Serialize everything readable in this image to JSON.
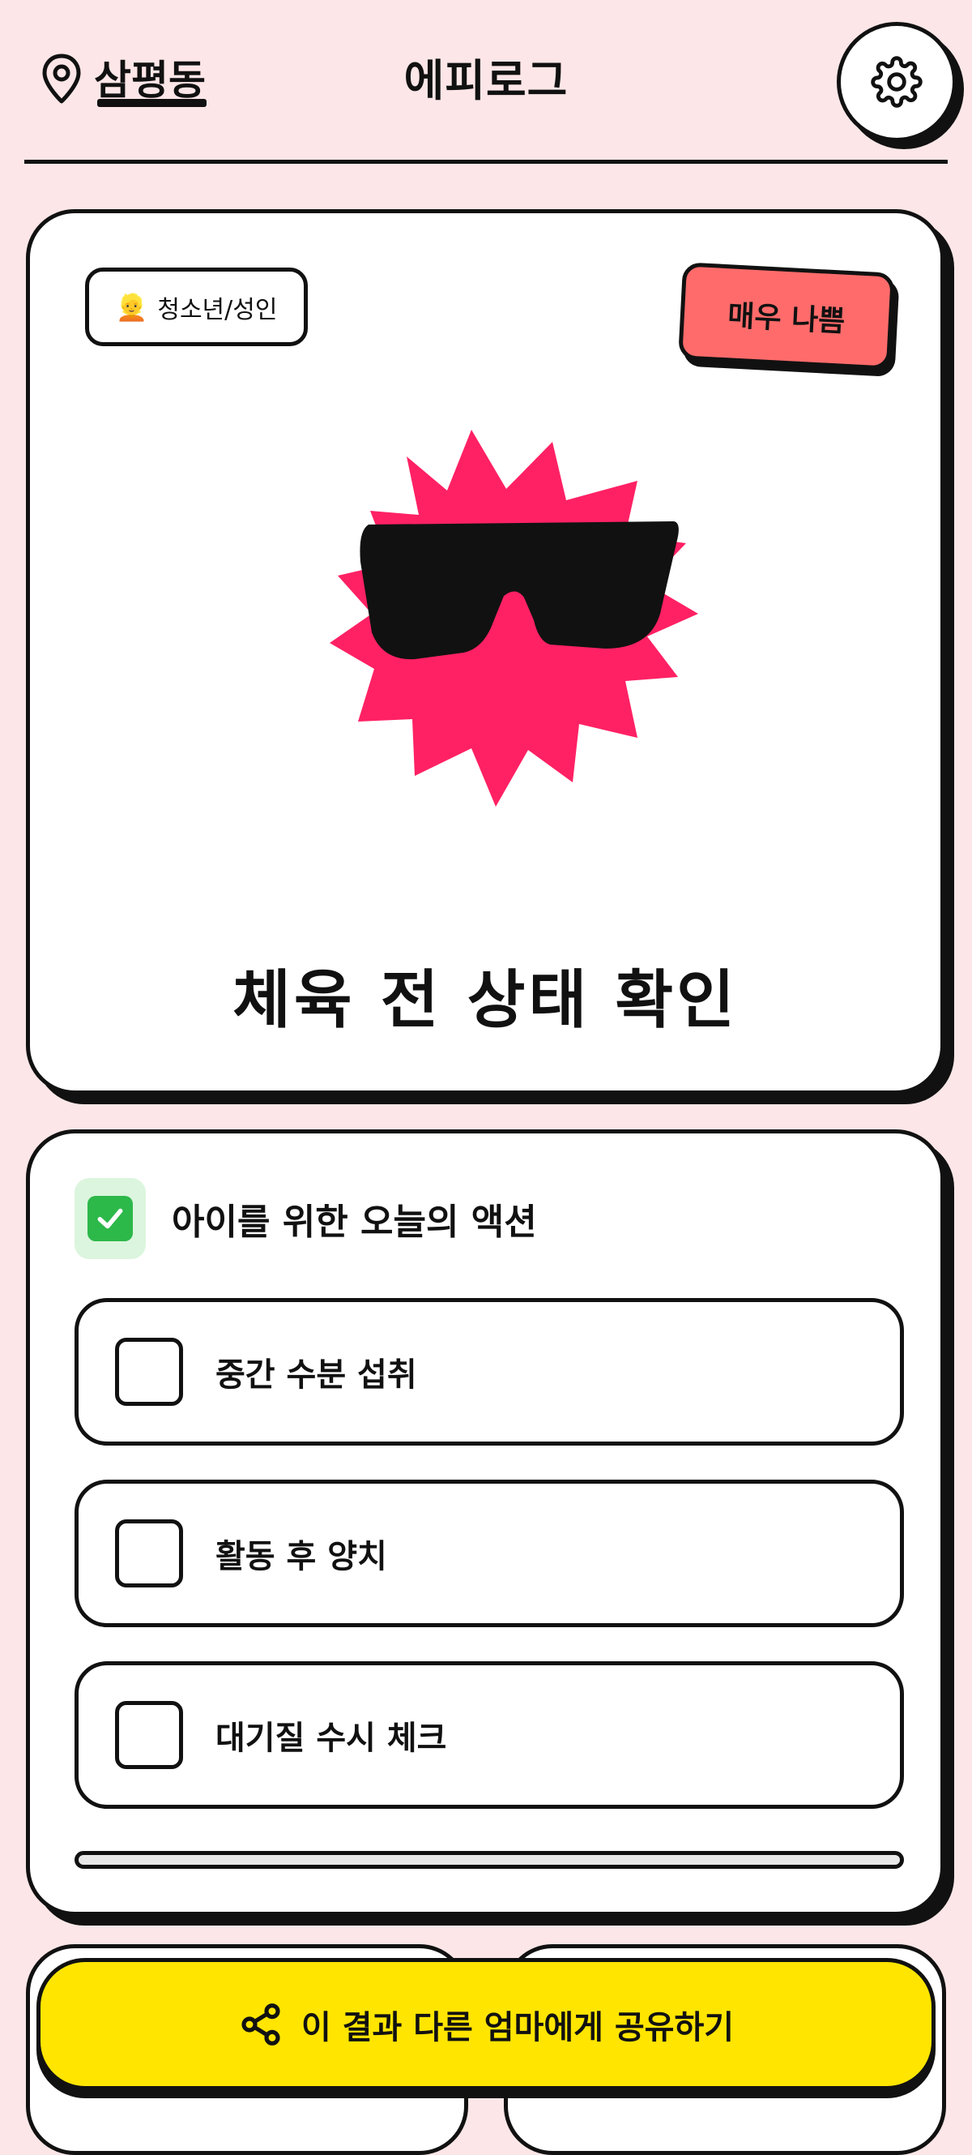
{
  "header": {
    "location": "삼평동",
    "title": "에피로그",
    "location_icon": "map-pin-icon",
    "settings_icon": "gear-icon"
  },
  "status_card": {
    "age_group_emoji": "👱",
    "age_group": "청소년/성인",
    "status": "매우 나쁨",
    "status_color": "#ff6b6b",
    "illustration": "sun-with-sunglasses",
    "illustration_color": "#ff2164",
    "headline": "체육 전 상태 확인"
  },
  "actions": {
    "icon": "checkmark-icon",
    "title": "아이를 위한 오늘의 액션",
    "items": [
      {
        "label": "중간 수분 섭취",
        "checked": false
      },
      {
        "label": "활동 후 양치",
        "checked": false
      },
      {
        "label": "대기질 수시 체크",
        "checked": false
      }
    ],
    "progress": 0
  },
  "share": {
    "icon": "share-icon",
    "label": "이 결과 다른 엄마에게 공유하기",
    "color": "#ffe500"
  }
}
